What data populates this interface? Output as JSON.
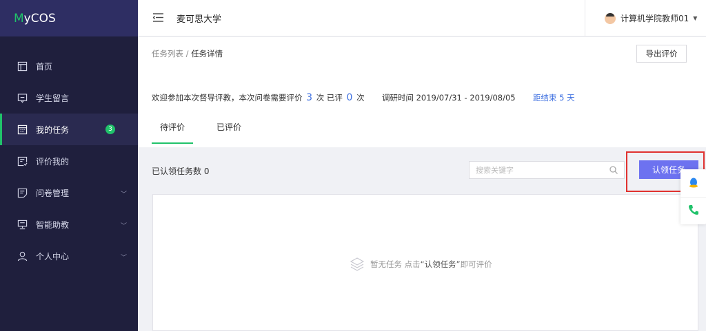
{
  "brand": {
    "logo_first": "M",
    "logo_rest": "yCOS"
  },
  "sidebar": {
    "items": [
      {
        "label": "首页",
        "icon": "layout-icon"
      },
      {
        "label": "学生留言",
        "icon": "message-icon"
      },
      {
        "label": "我的任务",
        "icon": "calendar-icon",
        "badge": "3"
      },
      {
        "label": "评价我的",
        "icon": "evaluation-icon"
      },
      {
        "label": "问卷管理",
        "icon": "questionnaire-icon"
      },
      {
        "label": "智能助教",
        "icon": "assistant-icon"
      },
      {
        "label": "个人中心",
        "icon": "user-icon"
      }
    ],
    "active_index": 2
  },
  "header": {
    "school": "麦可思大学",
    "user_name": "计算机学院教师01"
  },
  "breadcrumb": {
    "parent": "任务列表",
    "separator": " / ",
    "current": "任务详情"
  },
  "export_label": "导出评价",
  "info": {
    "prefix": "欢迎参加本次督导评教，本次问卷需要评价",
    "required": "3",
    "mid1": "次 已评",
    "done": "0",
    "mid2": "次",
    "period_label": "调研时间 2019/07/31 - 2019/08/05",
    "remaining": "距结束 5 天"
  },
  "tabs": [
    {
      "label": "待评价"
    },
    {
      "label": "已评价"
    }
  ],
  "active_tab": 0,
  "toolbar": {
    "count_label": "已认领任务数 0",
    "search_placeholder": "搜索关键字",
    "claim_label": "认领任务"
  },
  "empty": {
    "text_before": "暂无任务 点击",
    "text_bold": "“认领任务”",
    "text_after": "即可评价"
  },
  "colors": {
    "sidebar_bg": "#1f1f3d",
    "logo_bg": "#2e2e63",
    "accent_green": "#20c26a",
    "link_blue": "#3d6fe0",
    "button_purple": "#6d72f0",
    "highlight_red": "#e0312f"
  }
}
